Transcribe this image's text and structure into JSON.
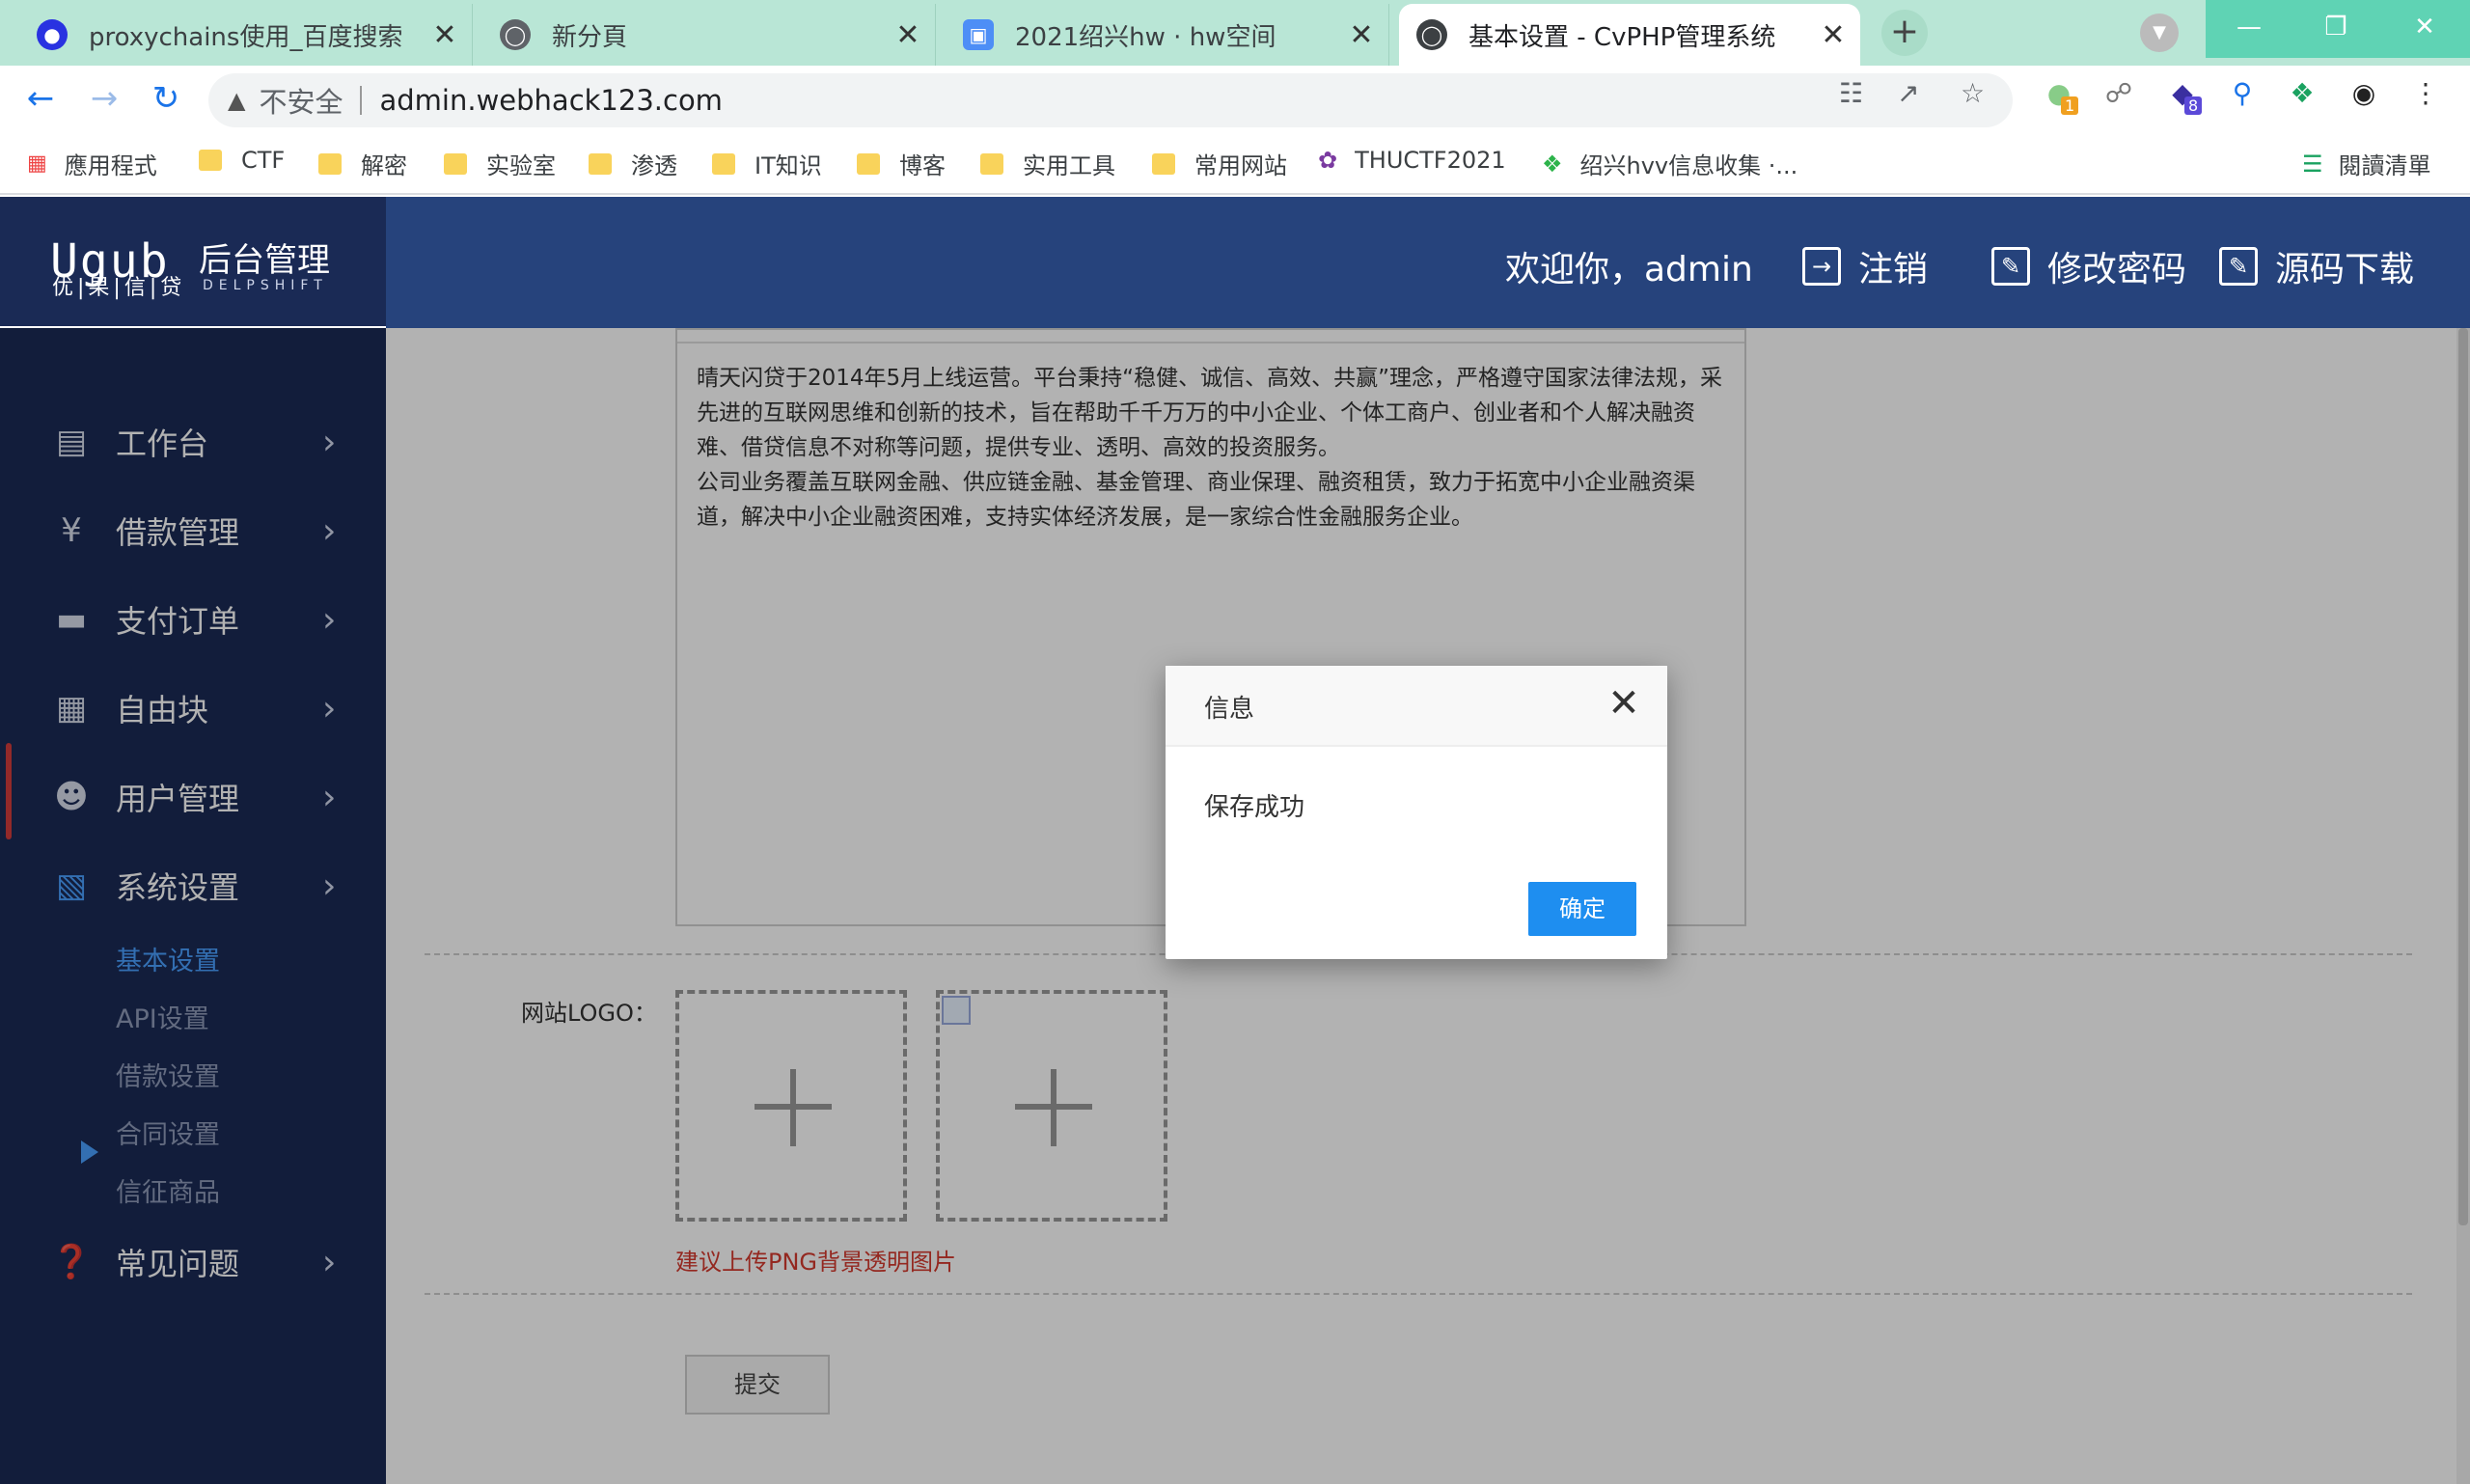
{
  "browser": {
    "tabs": [
      {
        "title": "proxychains使用_百度搜索",
        "icon": "baidu-paw-icon"
      },
      {
        "title": "新分頁",
        "icon": "globe-icon"
      },
      {
        "title": "2021绍兴hw · hw空间",
        "icon": "box-icon"
      },
      {
        "title": "基本设置 - CvPHP管理系统",
        "icon": "globe-icon"
      }
    ],
    "new_tab": "+",
    "address": {
      "security": "不安全",
      "url": "admin.webhack123.com"
    },
    "ext_badges": {
      "first": "1",
      "second": "8"
    },
    "bookmarks": [
      {
        "label": "應用程式",
        "icon": "apps-grid-icon"
      },
      {
        "label": "CTF",
        "icon": "folder-icon"
      },
      {
        "label": "解密",
        "icon": "folder-icon"
      },
      {
        "label": "实验室",
        "icon": "folder-icon"
      },
      {
        "label": "渗透",
        "icon": "folder-icon"
      },
      {
        "label": "IT知识",
        "icon": "folder-icon"
      },
      {
        "label": "博客",
        "icon": "folder-icon"
      },
      {
        "label": "实用工具",
        "icon": "folder-icon"
      },
      {
        "label": "常用网站",
        "icon": "folder-icon"
      },
      {
        "label": "THUCTF2021",
        "icon": "lotus-icon"
      },
      {
        "label": "绍兴hvv信息收集 ·...",
        "icon": "leaf-icon"
      }
    ],
    "reading_list": "閱讀清單"
  },
  "brand": {
    "mark": "Ugub",
    "sub": "优|果|信|贷",
    "title": "后台管理",
    "en": "DELPSHIFT"
  },
  "header": {
    "welcome": "欢迎你，admin",
    "logout": "注销",
    "change_password": "修改密码",
    "download": "源码下载"
  },
  "sidebar": {
    "items": [
      {
        "label": "工作台",
        "icon": "monitor-icon"
      },
      {
        "label": "借款管理",
        "icon": "loan-icon"
      },
      {
        "label": "支付订单",
        "icon": "card-icon"
      },
      {
        "label": "自由块",
        "icon": "grid-icon"
      },
      {
        "label": "用户管理",
        "icon": "user-icon"
      },
      {
        "label": "系统设置",
        "icon": "windows-icon"
      }
    ],
    "sub_items": [
      "基本设置",
      "API设置",
      "借款设置",
      "合同设置",
      "信征商品"
    ],
    "faq": {
      "label": "常见问题",
      "icon": "question-icon"
    }
  },
  "content": {
    "editor_text_1": "晴天闪贷于2014年5月上线运营。平台秉持“稳健、诚信、高效、共赢”理念，严格遵守国家法律法规，采先进的互联网思维和创新的技术，旨在帮助千千万万的中小企业、个体工商户、创业者和个人解决融资难、借贷信息不对称等问题，提供专业、透明、高效的投资服务。",
    "editor_text_2": "公司业务覆盖互联网金融、供应链金融、基金管理、商业保理、融资租赁，致力于拓宽中小企业融资渠道，解决中小企业融资困难，支持实体经济发展，是一家综合性金融服务企业。",
    "logo_label": "网站LOGO：",
    "hint": "建议上传PNG背景透明图片",
    "submit": "提交"
  },
  "dialog": {
    "title": "信息",
    "message": "保存成功",
    "ok": "确定"
  },
  "colors": {
    "sidebar_bg": "#1a2a55",
    "header_bg": "#26437c",
    "accent": "#1e8ef0",
    "hint_red": "#d43a2f",
    "tab_strip": "#b9e6d6"
  }
}
